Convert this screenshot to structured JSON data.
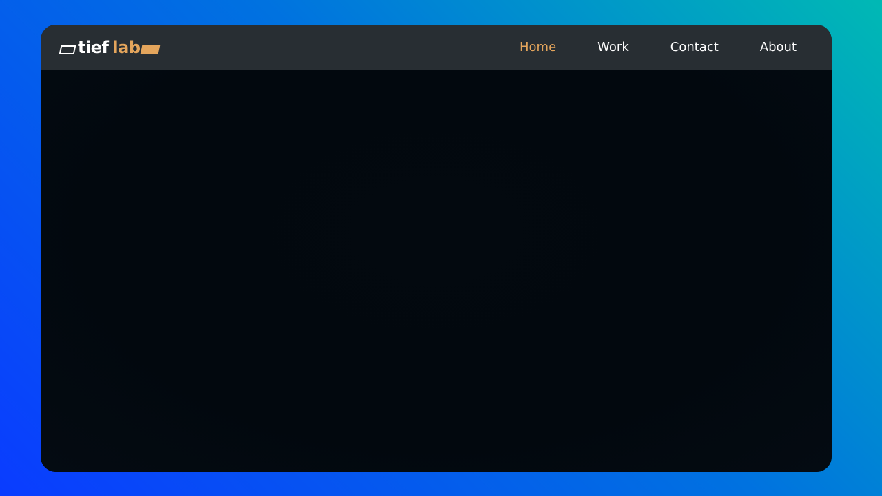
{
  "logo": {
    "word1": "tief",
    "word2": "lab"
  },
  "nav": {
    "items": [
      {
        "label": "Home",
        "active": true
      },
      {
        "label": "Work",
        "active": false
      },
      {
        "label": "Contact",
        "active": false
      },
      {
        "label": "About",
        "active": false
      }
    ]
  },
  "colors": {
    "accent": "#e4a55c",
    "navbar": "#282e33",
    "content": "#030a10",
    "background_start": "#0a3cff",
    "background_end": "#00b9b4"
  }
}
